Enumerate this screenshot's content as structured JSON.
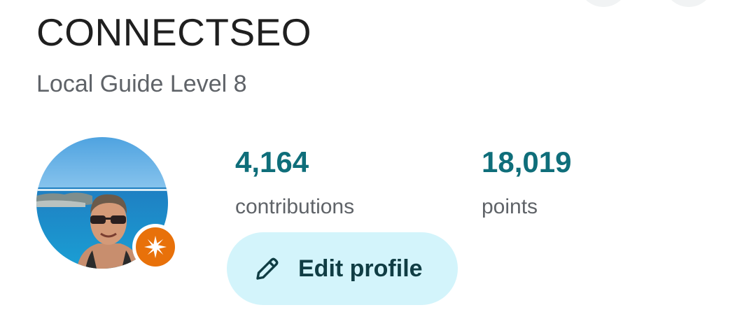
{
  "profile": {
    "name": "CONNECTSEO",
    "level": "Local Guide Level 8",
    "avatar": "profile-photo-beach",
    "badge_icon": "local-guide-star-badge",
    "badge_color": "#e8710a"
  },
  "stats": [
    {
      "value": "4,164",
      "label": "contributions"
    },
    {
      "value": "18,019",
      "label": "points"
    }
  ],
  "actions": {
    "edit_profile": {
      "label": "Edit profile",
      "icon": "pencil-icon"
    }
  },
  "colors": {
    "accent": "#0f6e7a",
    "button_bg": "#d3f4fb",
    "badge": "#e8710a"
  }
}
